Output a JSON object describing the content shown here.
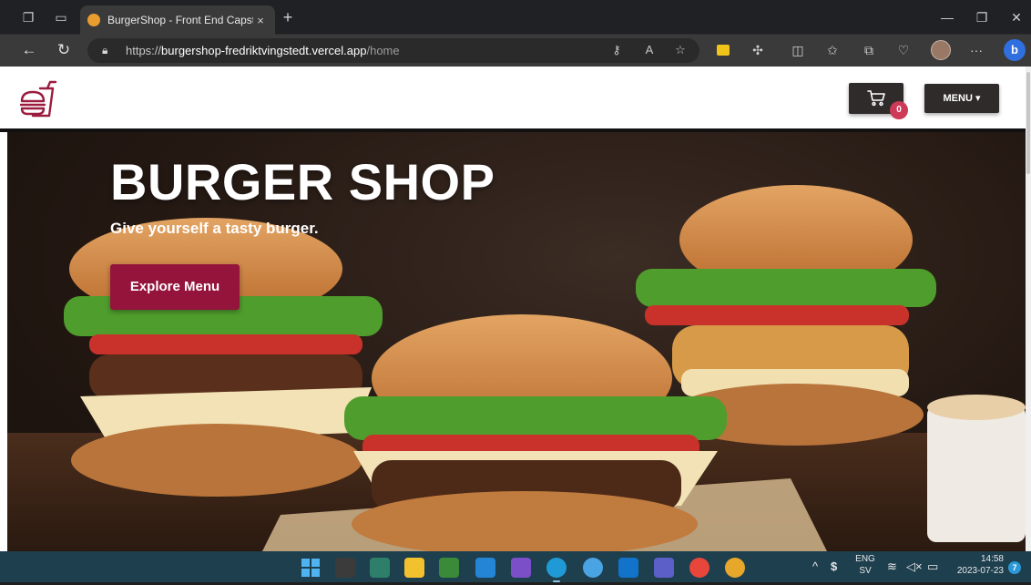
{
  "browser": {
    "tab_title": "BurgerShop - Front End Capstone",
    "tab_close": "×",
    "new_tab": "+",
    "url_scheme": "https://",
    "url_host": "burgershop-fredriktvingstedt.vercel.app",
    "url_path": "/home",
    "more_label": "···"
  },
  "header": {
    "cart_count": "0",
    "menu_label": "MENU ▾"
  },
  "hero": {
    "title": "BURGER SHOP",
    "subtitle": "Give yourself a tasty burger.",
    "button_label": "Explore Menu"
  },
  "taskbar": {
    "lang_top": "ENG",
    "lang_bottom": "SV",
    "time": "14:58",
    "date": "2023-07-23",
    "notification_count": "7"
  },
  "colors": {
    "brand_red": "#95143c",
    "logo_color": "#9b1c3f",
    "badge": "#cc3a57",
    "header_button": "#2f2b2b"
  }
}
